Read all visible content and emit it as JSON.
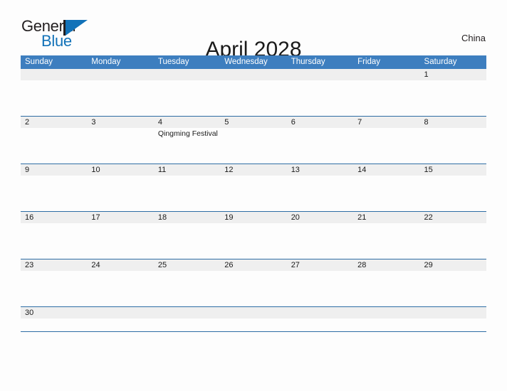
{
  "brand": {
    "name_top": "General",
    "name_bottom": "Blue",
    "mark": "triangle-logo-icon",
    "color_dark": "#231f20",
    "color_blue": "#1272b8"
  },
  "header": {
    "title": "April 2028",
    "country": "China"
  },
  "calendar": {
    "header_bg": "#3d7ebf",
    "row_border": "#2e6da4",
    "date_strip_bg": "#efefef",
    "weekdays": [
      "Sunday",
      "Monday",
      "Tuesday",
      "Wednesday",
      "Thursday",
      "Friday",
      "Saturday"
    ],
    "weeks": [
      {
        "days": [
          {
            "date": "",
            "events": []
          },
          {
            "date": "",
            "events": []
          },
          {
            "date": "",
            "events": []
          },
          {
            "date": "",
            "events": []
          },
          {
            "date": "",
            "events": []
          },
          {
            "date": "",
            "events": []
          },
          {
            "date": "1",
            "events": []
          }
        ]
      },
      {
        "days": [
          {
            "date": "2",
            "events": []
          },
          {
            "date": "3",
            "events": []
          },
          {
            "date": "4",
            "events": [
              "Qingming Festival"
            ]
          },
          {
            "date": "5",
            "events": []
          },
          {
            "date": "6",
            "events": []
          },
          {
            "date": "7",
            "events": []
          },
          {
            "date": "8",
            "events": []
          }
        ]
      },
      {
        "days": [
          {
            "date": "9",
            "events": []
          },
          {
            "date": "10",
            "events": []
          },
          {
            "date": "11",
            "events": []
          },
          {
            "date": "12",
            "events": []
          },
          {
            "date": "13",
            "events": []
          },
          {
            "date": "14",
            "events": []
          },
          {
            "date": "15",
            "events": []
          }
        ]
      },
      {
        "days": [
          {
            "date": "16",
            "events": []
          },
          {
            "date": "17",
            "events": []
          },
          {
            "date": "18",
            "events": []
          },
          {
            "date": "19",
            "events": []
          },
          {
            "date": "20",
            "events": []
          },
          {
            "date": "21",
            "events": []
          },
          {
            "date": "22",
            "events": []
          }
        ]
      },
      {
        "days": [
          {
            "date": "23",
            "events": []
          },
          {
            "date": "24",
            "events": []
          },
          {
            "date": "25",
            "events": []
          },
          {
            "date": "26",
            "events": []
          },
          {
            "date": "27",
            "events": []
          },
          {
            "date": "28",
            "events": []
          },
          {
            "date": "29",
            "events": []
          }
        ]
      },
      {
        "days": [
          {
            "date": "30",
            "events": []
          },
          {
            "date": "",
            "events": []
          },
          {
            "date": "",
            "events": []
          },
          {
            "date": "",
            "events": []
          },
          {
            "date": "",
            "events": []
          },
          {
            "date": "",
            "events": []
          },
          {
            "date": "",
            "events": []
          }
        ]
      }
    ]
  }
}
